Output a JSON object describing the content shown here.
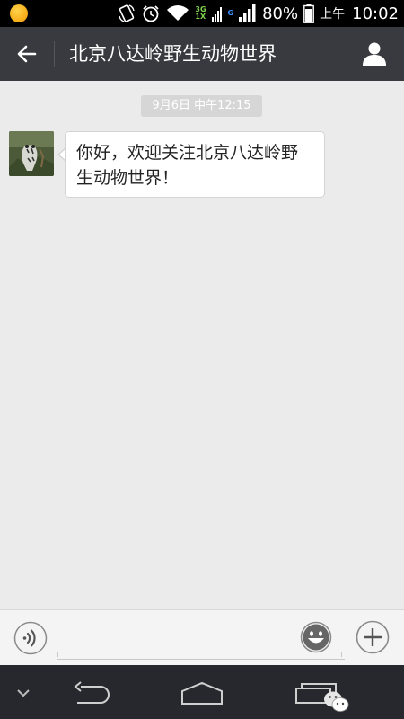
{
  "status_bar": {
    "network_top": "3G",
    "network_bottom": "1X",
    "network_g": "G",
    "battery": "80%",
    "ampm": "上午",
    "time": "10:02"
  },
  "header": {
    "title": "北京八达岭野生动物世界"
  },
  "chat": {
    "timestamp": "9月6日 中午12:15",
    "messages": [
      {
        "text": "你好，欢迎关注北京八达岭野生动物世界！"
      }
    ]
  },
  "input_bar": {
    "value": "",
    "placeholder": ""
  },
  "colors": {
    "title_bar": "#393a3f",
    "chat_background": "#ebebeb",
    "nav_bar": "#27282d"
  }
}
